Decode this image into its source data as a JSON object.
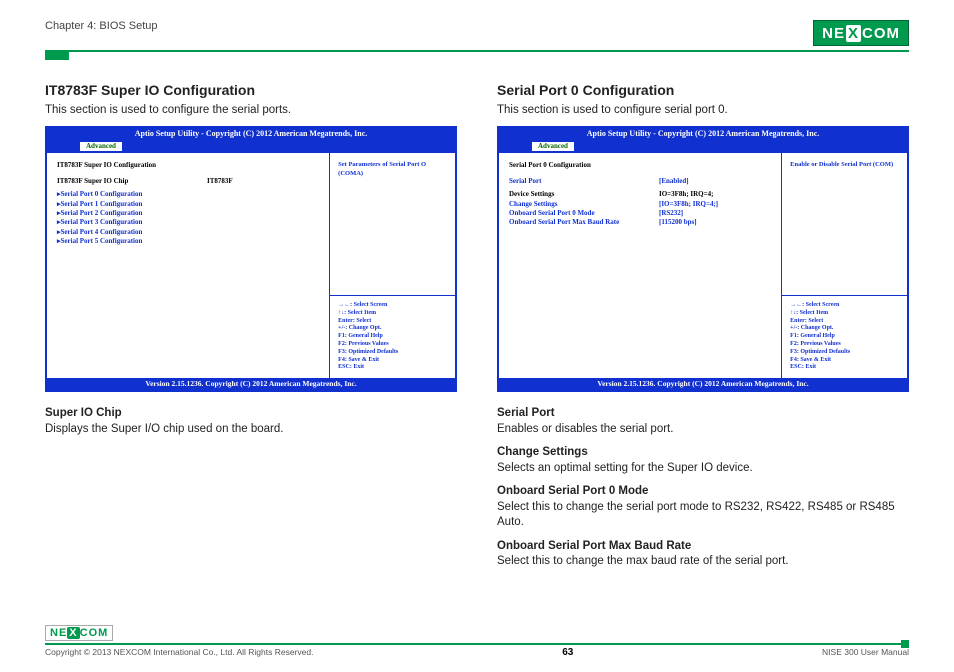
{
  "header": {
    "chapter": "Chapter 4: BIOS Setup",
    "logo_text": "NEXCOM"
  },
  "left": {
    "title": "IT8783F Super IO Configuration",
    "subtitle": "This section is used to configure the serial ports.",
    "bios": {
      "title": "Aptio Setup Utility - Copyright (C) 2012 American Megatrends, Inc.",
      "tab": "Advanced",
      "rows": [
        {
          "label": "IT8783F Super IO Configuration",
          "value": "",
          "black": true
        },
        {
          "label": "IT8783F Super IO Chip",
          "value": "IT8783F",
          "black": true
        },
        {
          "label": "Serial Port 0 Configuration",
          "value": "",
          "tri": true
        },
        {
          "label": "Serial Port 1 Configuration",
          "value": "",
          "tri": true
        },
        {
          "label": "Serial Port 2 Configuration",
          "value": "",
          "tri": true
        },
        {
          "label": "Serial Port 3 Configuration",
          "value": "",
          "tri": true
        },
        {
          "label": "Serial Port 4 Configuration",
          "value": "",
          "tri": true
        },
        {
          "label": "Serial Port 5 Configuration",
          "value": "",
          "tri": true
        }
      ],
      "help": "Set Parameters of Serial Port O (COMA)",
      "keys": [
        "→←: Select Screen",
        "↑↓: Select Item",
        "Enter: Select",
        "+/-: Change Opt.",
        "F1: General Help",
        "F2: Previous Values",
        "F3: Optimized Defaults",
        "F4: Save & Exit",
        "ESC: Exit"
      ],
      "footer": "Version 2.15.1236. Copyright (C) 2012 American Megatrends, Inc."
    },
    "desc": [
      {
        "h": "Super IO Chip",
        "t": "Displays the Super I/O chip used on the board."
      }
    ]
  },
  "right": {
    "title": "Serial Port 0 Configuration",
    "subtitle": "This section is used to configure serial port 0.",
    "bios": {
      "title": "Aptio Setup Utility - Copyright (C) 2012 American Megatrends, Inc.",
      "tab": "Advanced",
      "rows": [
        {
          "label": "Serial Port 0 Configuration",
          "value": "",
          "black": true
        },
        {
          "label": "Serial Port",
          "value": "[Enabled]"
        },
        {
          "label": "Device Settings",
          "value": "IO=3F8h; IRQ=4;",
          "black": true
        },
        {
          "label": "",
          "value": ""
        },
        {
          "label": "Change Settings",
          "value": "[IO=3F8h; IRQ=4;]"
        },
        {
          "label": "Onboard Serial Port 0 Mode",
          "value": "[RS232]"
        },
        {
          "label": "Onboard Serial Port Max Baud Rate",
          "value": "[115200 bps]"
        }
      ],
      "help": "Enable or Disable Serial Port (COM)",
      "keys": [
        "→←: Select Screen",
        "↑↓: Select Item",
        "Enter: Select",
        "+/-: Change Opt.",
        "F1: General Help",
        "F2: Previous Values",
        "F3: Optimized Defaults",
        "F4: Save & Exit",
        "ESC: Exit"
      ],
      "footer": "Version 2.15.1236. Copyright (C) 2012 American Megatrends, Inc."
    },
    "desc": [
      {
        "h": "Serial Port",
        "t": "Enables or disables the serial port."
      },
      {
        "h": "Change Settings",
        "t": "Selects an optimal setting for the Super IO device."
      },
      {
        "h": "Onboard Serial Port 0 Mode",
        "t": "Select this to change the serial port mode to RS232, RS422, RS485 or RS485 Auto."
      },
      {
        "h": "Onboard Serial Port Max Baud Rate",
        "t": "Select this to change the max baud rate of the serial port."
      }
    ]
  },
  "footer": {
    "copyright": "Copyright © 2013 NEXCOM International Co., Ltd. All Rights Reserved.",
    "page": "63",
    "manual": "NISE 300 User Manual"
  }
}
